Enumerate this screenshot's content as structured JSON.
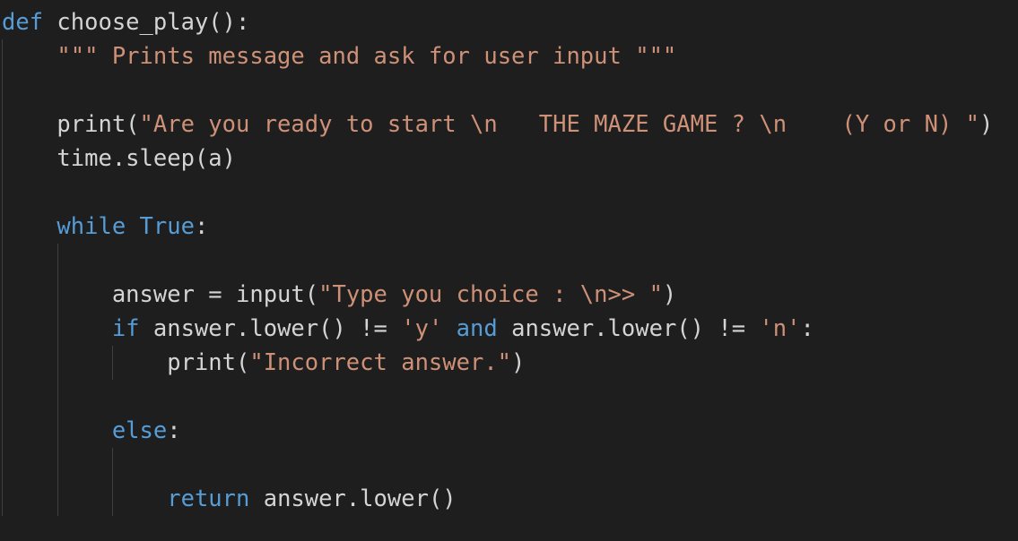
{
  "editor": {
    "language": "python",
    "colors": {
      "background": "#1e1e1e",
      "keyword": "#569cd6",
      "string": "#ce9178",
      "plain": "#d4d4d4",
      "indent_guide": "#404040"
    },
    "lines": [
      {
        "tokens": [
          {
            "type": "kw",
            "text": "def"
          },
          {
            "type": "pl",
            "text": " choose_play():"
          }
        ]
      },
      {
        "tokens": [
          {
            "type": "pl",
            "text": "    "
          },
          {
            "type": "str",
            "text": "\"\"\" Prints message and ask for user input \"\"\""
          }
        ]
      },
      {
        "tokens": []
      },
      {
        "tokens": [
          {
            "type": "pl",
            "text": "    print("
          },
          {
            "type": "str",
            "text": "\"Are you ready to start \\n   THE MAZE GAME ? \\n    (Y or N) \""
          },
          {
            "type": "pl",
            "text": ")"
          }
        ]
      },
      {
        "tokens": [
          {
            "type": "pl",
            "text": "    time.sleep(a)"
          }
        ]
      },
      {
        "tokens": []
      },
      {
        "tokens": [
          {
            "type": "pl",
            "text": "    "
          },
          {
            "type": "kw",
            "text": "while"
          },
          {
            "type": "pl",
            "text": " "
          },
          {
            "type": "kw",
            "text": "True"
          },
          {
            "type": "pl",
            "text": ":"
          }
        ]
      },
      {
        "tokens": []
      },
      {
        "tokens": [
          {
            "type": "pl",
            "text": "        answer = input("
          },
          {
            "type": "str",
            "text": "\"Type you choice : \\n>> \""
          },
          {
            "type": "pl",
            "text": ")"
          }
        ]
      },
      {
        "tokens": [
          {
            "type": "pl",
            "text": "        "
          },
          {
            "type": "kw",
            "text": "if"
          },
          {
            "type": "pl",
            "text": " answer.lower() != "
          },
          {
            "type": "str",
            "text": "'y'"
          },
          {
            "type": "pl",
            "text": " "
          },
          {
            "type": "kw",
            "text": "and"
          },
          {
            "type": "pl",
            "text": " answer.lower() != "
          },
          {
            "type": "str",
            "text": "'n'"
          },
          {
            "type": "pl",
            "text": ":"
          }
        ]
      },
      {
        "tokens": [
          {
            "type": "pl",
            "text": "            print("
          },
          {
            "type": "str",
            "text": "\"Incorrect answer.\""
          },
          {
            "type": "pl",
            "text": ")"
          }
        ]
      },
      {
        "tokens": []
      },
      {
        "tokens": [
          {
            "type": "pl",
            "text": "        "
          },
          {
            "type": "kw",
            "text": "else"
          },
          {
            "type": "pl",
            "text": ":"
          }
        ]
      },
      {
        "tokens": []
      },
      {
        "tokens": [
          {
            "type": "pl",
            "text": "            "
          },
          {
            "type": "kw",
            "text": "return"
          },
          {
            "type": "pl",
            "text": " answer.lower()"
          }
        ]
      }
    ]
  }
}
